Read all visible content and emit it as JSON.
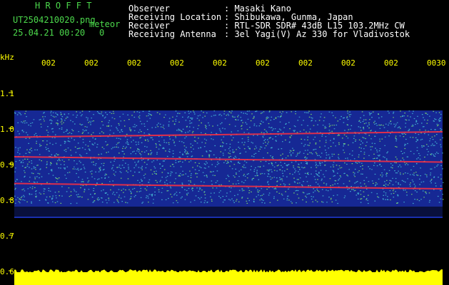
{
  "header": {
    "title": "H R O F F T",
    "filename": "UT2504210020.png",
    "meteor_label": "meteor",
    "datetime": "25.04.21 00:20",
    "meteor_count": "0",
    "labels": [
      "Observer",
      "Receiving Location",
      "Receiver",
      "Receiving Antenna"
    ],
    "values": [
      ": Masaki Kano",
      ": Shibukawa, Gunma, Japan",
      ": RTL-SDR SDR# 43dB L15 103.2MHz CW",
      ": 3el Yagi(V) Az 330 for Vladivostok"
    ]
  },
  "chart_data": {
    "type": "heatmap",
    "ylabel": "kHz",
    "y_ticks": [
      "1.1",
      "1.0",
      "0.9",
      "0.8",
      "0.7",
      "0.6"
    ],
    "x_ticks": [
      "002",
      "002",
      "002",
      "002",
      "002",
      "002",
      "002",
      "002",
      "002",
      "0030"
    ],
    "ylim": [
      0.6,
      1.1
    ],
    "signal_band_khz": [
      0.75,
      1.05
    ],
    "lines_khz": [
      {
        "start": 0.975,
        "end": 0.99
      },
      {
        "start": 0.92,
        "end": 0.905
      },
      {
        "start": 0.845,
        "end": 0.83
      }
    ],
    "colors": {
      "background": "#000000",
      "noise": "#1a2fae",
      "signal_mid": "#4dd1e0",
      "signal_hi": "#8cf066",
      "line": "#ff3040",
      "baseline_bar": "#ffff00",
      "text": "#ffff00"
    }
  }
}
